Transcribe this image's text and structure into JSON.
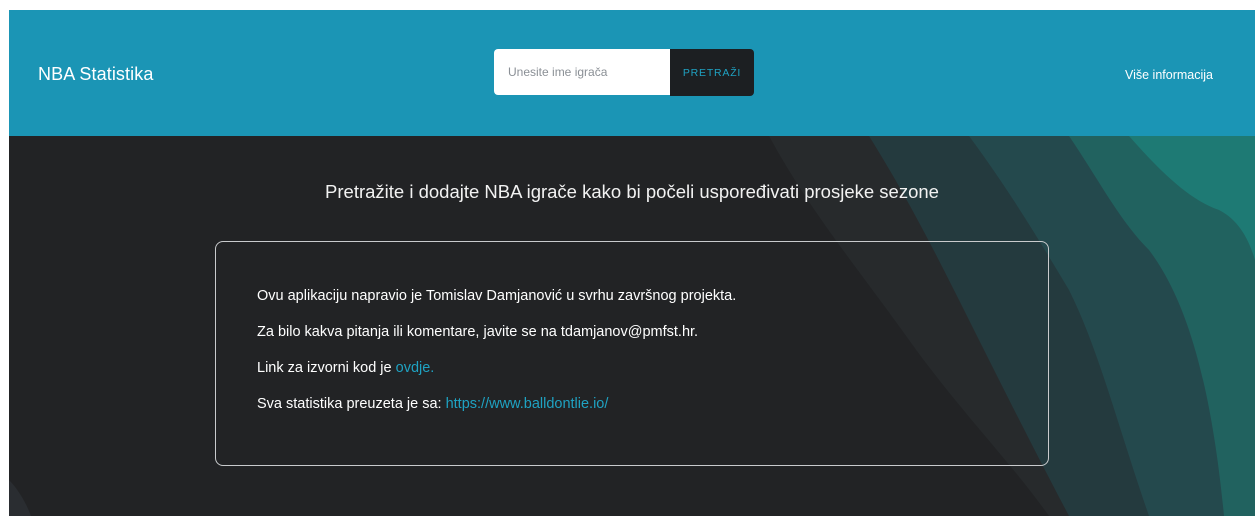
{
  "navbar": {
    "brand": "NBA Statistika",
    "search_placeholder": "Unesite ime igrača",
    "search_value": "",
    "search_button_label": "PRETRAŽI",
    "more_info_link": "Više informacija"
  },
  "main": {
    "headline": "Pretražite i dodajte NBA igrače kako bi počeli uspoređivati prosjeke sezone",
    "info": {
      "line1": "Ovu aplikaciju napravio je Tomislav Damjanović u svrhu završnog projekta.",
      "line2": "Za bilo kakva pitanja ili komentare, javite se na tdamjanov@pmfst.hr.",
      "line3_text": "Link za izvorni kod je ",
      "line3_link": "ovdje.",
      "line4_text": "Sva statistika preuzeta je sa: ",
      "line4_link": "https://www.balldontlie.io/"
    }
  },
  "colors": {
    "navbar_bg": "#1b95b5",
    "page_bg": "#222325",
    "accent_link": "#1fa2c2",
    "button_bg": "#1c1f22"
  }
}
